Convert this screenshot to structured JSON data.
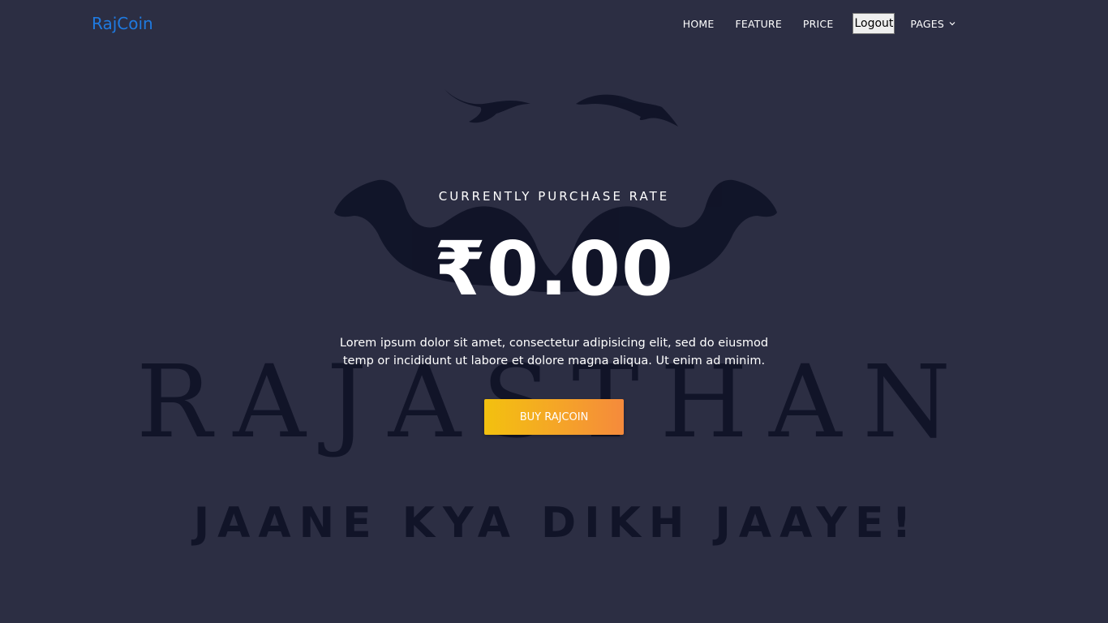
{
  "brand": {
    "name": "RajCoin",
    "color": "#1f7ae0"
  },
  "nav": {
    "items": [
      "HOME",
      "FEATURE",
      "PRICE"
    ],
    "logout_label": "Logout",
    "pages_label": "PAGES"
  },
  "hero": {
    "kicker": "CURRENTLY PURCHASE RATE",
    "rate": "₹0.00",
    "description": "Lorem ipsum dolor sit amet, consectetur adipisicing elit, sed do eiusmod temp or incididunt ut labore et dolore magna aliqua. Ut enim ad minim.",
    "buy_label": "BUY RAJCOIN"
  },
  "background_art": {
    "logo_text": "RAJASTHAN",
    "tagline": "JAANE KYA DIKH JAAYE!",
    "icons": [
      "bird-icon",
      "camel-icon"
    ]
  },
  "colors": {
    "background": "#2c2e43",
    "art": "#0d1024",
    "button_start": "#f3c10f",
    "button_end": "#f58a3c"
  }
}
